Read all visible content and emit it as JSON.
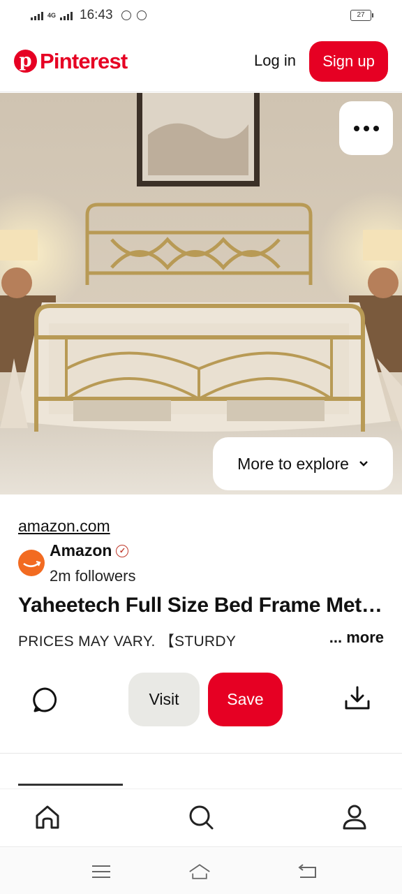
{
  "status_bar": {
    "time": "16:43",
    "network": "4G",
    "battery": "27"
  },
  "header": {
    "logo_mark": "p",
    "logo_text": "Pinterest",
    "login_label": "Log in",
    "signup_label": "Sign up"
  },
  "hero": {
    "explore_label": "More to explore",
    "image_alt": "Gold metal bed frame in a bedroom"
  },
  "pin": {
    "source": "amazon.com",
    "brand_name": "Amazon",
    "followers": "2m followers",
    "title": "Yaheetech Full Size Bed Frame Met…",
    "description": "PRICES MAY VARY. 【STURDY",
    "more_label": "... more"
  },
  "actions": {
    "visit_label": "Visit",
    "save_label": "Save"
  },
  "colors": {
    "brand": "#e60023",
    "amazon": "#f26b21"
  },
  "icons": [
    "more-dots-icon",
    "chevron-down-icon",
    "verified-icon",
    "comment-icon",
    "download-icon",
    "home-icon",
    "search-icon",
    "profile-icon",
    "menu-icon",
    "system-home-icon",
    "back-icon"
  ]
}
